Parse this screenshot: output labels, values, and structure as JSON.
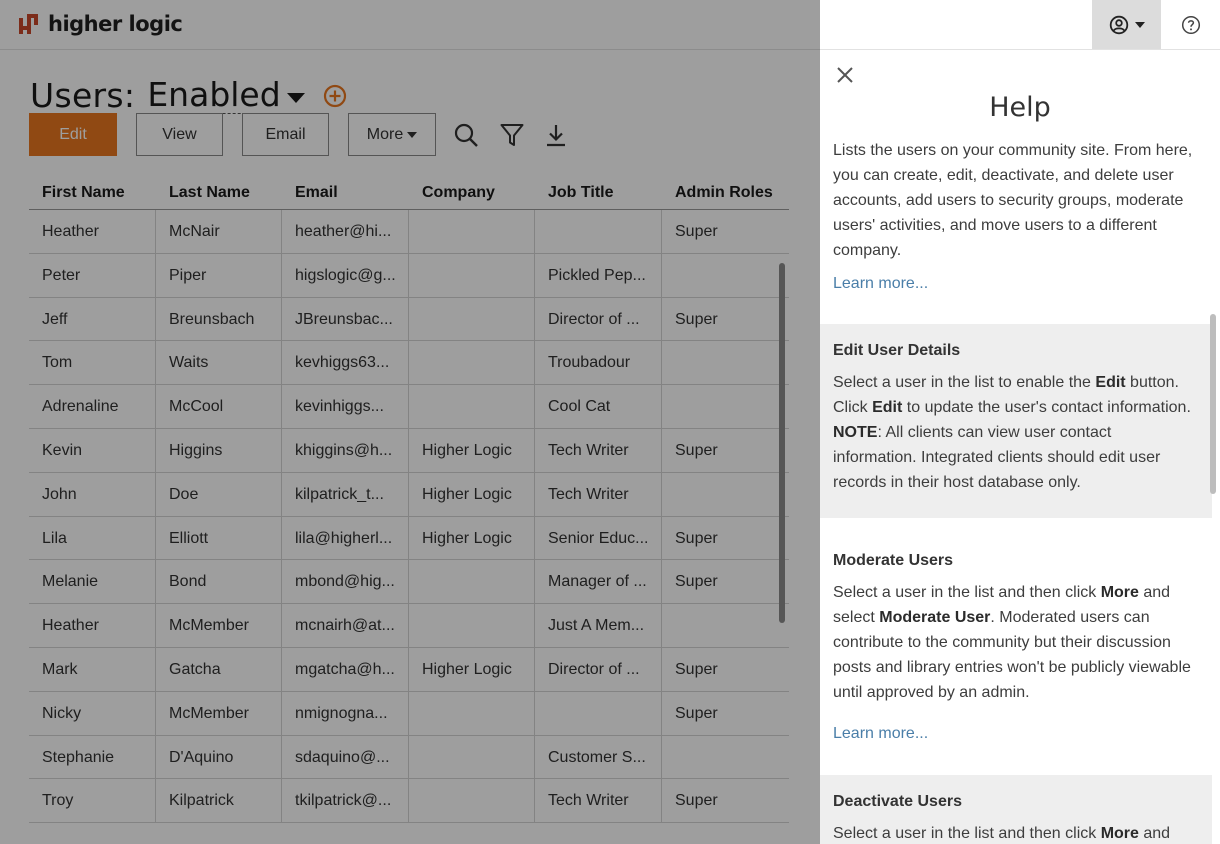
{
  "brand": {
    "name": "higher logic",
    "accent": "#c8472b"
  },
  "header": {
    "user_icon": "user-circle-icon",
    "help_icon": "question-circle-icon"
  },
  "page": {
    "title": "Users:",
    "status": "Enabled"
  },
  "toolbar": {
    "edit_label": "Edit",
    "view_label": "View",
    "email_label": "Email",
    "more_label": "More",
    "icons": [
      "search-icon",
      "filter-icon",
      "download-icon"
    ],
    "edit_color": "#e8761f"
  },
  "table": {
    "headers": [
      "First Name",
      "Last Name",
      "Email",
      "Company",
      "Job Title",
      "Admin Roles"
    ],
    "rows": [
      [
        "Heather",
        "McNair",
        "heather@hi...",
        "",
        "",
        "Super"
      ],
      [
        "Peter",
        "Piper",
        "higslogic@g...",
        "",
        "Pickled Pep...",
        ""
      ],
      [
        "Jeff",
        "Breunsbach",
        "JBreunsbac...",
        "",
        "Director of ...",
        "Super"
      ],
      [
        "Tom",
        "Waits",
        "kevhiggs63...",
        "",
        "Troubadour",
        ""
      ],
      [
        "Adrenaline",
        "McCool",
        "kevinhiggs...",
        "",
        "Cool Cat",
        ""
      ],
      [
        "Kevin",
        "Higgins",
        "khiggins@h...",
        "Higher Logic",
        "Tech Writer",
        "Super"
      ],
      [
        "John",
        "Doe",
        "kilpatrick_t...",
        "Higher Logic",
        "Tech Writer",
        ""
      ],
      [
        "Lila",
        "Elliott",
        "lila@higherl...",
        "Higher Logic",
        "Senior Educ...",
        "Super"
      ],
      [
        "Melanie",
        "Bond",
        "mbond@hig...",
        "",
        "Manager of ...",
        "Super"
      ],
      [
        "Heather",
        "McMember",
        "mcnairh@at...",
        "",
        "Just A Mem...",
        ""
      ],
      [
        "Mark",
        "Gatcha",
        "mgatcha@h...",
        "Higher Logic",
        "Director of ...",
        "Super"
      ],
      [
        "Nicky",
        "McMember",
        "nmignogna...",
        "",
        "",
        "Super"
      ],
      [
        "Stephanie",
        "D'Aquino",
        "sdaquino@...",
        "",
        "Customer S...",
        ""
      ],
      [
        "Troy",
        "Kilpatrick",
        "tkilpatrick@...",
        "",
        "Tech Writer",
        "Super"
      ]
    ]
  },
  "help": {
    "title": "Help",
    "intro": "Lists the users on your community site. From here, you can create, edit, deactivate, and delete user accounts, add users to security groups, moderate users' activities, and move users to a different company.",
    "learn_more": "Learn more...",
    "edit": {
      "heading": "Edit User Details",
      "t1": "Select a user in the list to enable the ",
      "b1": "Edit",
      "t2": " button. Click ",
      "b2": "Edit",
      "t3": " to update the user's contact information. ",
      "b3": "NOTE",
      "t4": ": All clients can view user contact information. Integrated clients should edit user records in their host database only."
    },
    "moderate": {
      "heading": "Moderate Users",
      "t1": "Select a user in the list and then click ",
      "b1": "More",
      "t2": " and select ",
      "b2": "Moderate User",
      "t3": ". Moderated users can contribute to the community but their discussion posts and library entries won't be publicly viewable until approved by an admin.",
      "learn_more": "Learn more..."
    },
    "deactivate": {
      "heading": "Deactivate Users",
      "t1": "Select a user in the list and then click ",
      "b1": "More",
      "t2": " and"
    }
  }
}
